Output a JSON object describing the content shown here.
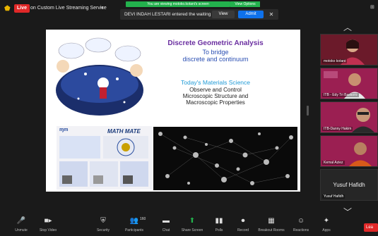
{
  "topbar": {
    "live_badge": "Live",
    "stream_label": "on Custom Live Streaming Service",
    "viewing_banner": "You are viewing motoko.kotani's screen",
    "view_options": "View Options",
    "notice_text": "DEVI INDAH LESTARI entered the waiting room",
    "view_button": "View",
    "admit_button": "Admit",
    "close_symbol": "✕"
  },
  "slide": {
    "title": "Discrete Geometric Analysis",
    "subtitle_line1": "To bridge",
    "subtitle_line2": "discrete and continuum",
    "heading": "Today's Materials Science",
    "body_line1": "Observe and Control",
    "body_line2": "Microscopic Structure and",
    "body_line3": "Macroscopic Properties",
    "mm_title": "MATH MATE",
    "mm_logo": "ɱm"
  },
  "participants": [
    {
      "name": "motoko kotani"
    },
    {
      "name": "ITB - Edy Tri Baskoro"
    },
    {
      "name": "ITB-Danny Hakim"
    },
    {
      "name": "Kemal Aziez"
    },
    {
      "name": "Yusuf Hafidh",
      "display_name": "Yusuf Hafidh"
    }
  ],
  "toolbar": {
    "unmute": "Unmute",
    "stop_video": "Stop Video",
    "security": "Security",
    "participants": "Participants",
    "participants_count": "160",
    "chat": "Chat",
    "share_screen": "Share Screen",
    "polls": "Polls",
    "record": "Record",
    "breakout": "Breakout Rooms",
    "reactions": "Reactions",
    "apps": "Apps",
    "leave": "Lea"
  },
  "colors": {
    "zoom_blue": "#0e71eb",
    "share_green": "#23b14d",
    "live_red": "#e02828",
    "tile_magenta": "#9b1f52"
  }
}
